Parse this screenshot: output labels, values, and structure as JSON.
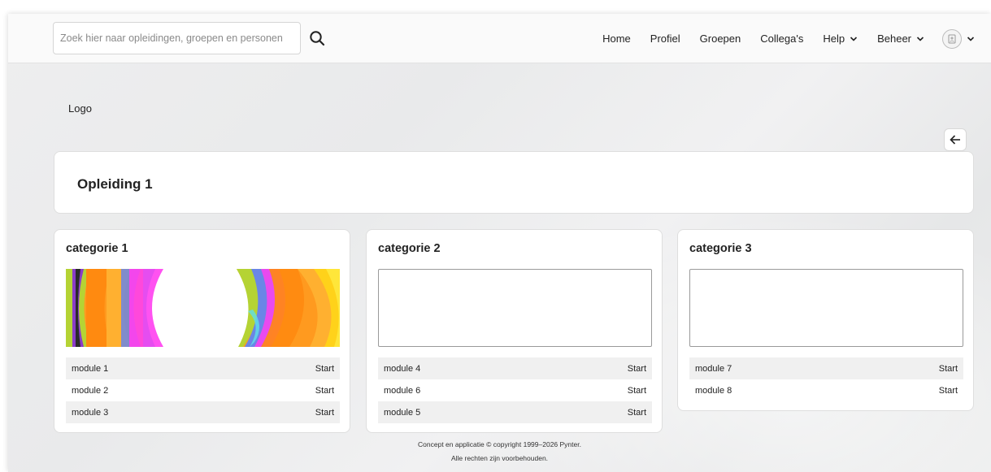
{
  "search": {
    "placeholder": "Zoek hier naar opleidingen, groepen en personen",
    "value": ""
  },
  "nav": {
    "home": "Home",
    "profiel": "Profiel",
    "groepen": "Groepen",
    "collegas": "Collega's",
    "help": "Help",
    "beheer": "Beheer"
  },
  "logo": "Logo",
  "page_title": "Opleiding 1",
  "categories": [
    {
      "title": "categorie 1",
      "modules": [
        {
          "name": "module 1",
          "action": "Start"
        },
        {
          "name": "module 2",
          "action": "Start"
        },
        {
          "name": "module 3",
          "action": "Start"
        }
      ]
    },
    {
      "title": "categorie 2",
      "modules": [
        {
          "name": "module 4",
          "action": "Start"
        },
        {
          "name": "module 6",
          "action": "Start"
        },
        {
          "name": "module 5",
          "action": "Start"
        }
      ]
    },
    {
      "title": "categorie 3",
      "modules": [
        {
          "name": "module 7",
          "action": "Start"
        },
        {
          "name": "module 8",
          "action": "Start"
        }
      ]
    }
  ],
  "footer": {
    "line1": "Concept en applicatie © copyright 1999–2026 Pynter.",
    "line2": "Alle rechten zijn voorbehouden."
  },
  "icons": {
    "search": "search-icon",
    "chevron": "chevron-down-icon",
    "avatar": "user-avatar-icon",
    "back": "arrow-left-icon"
  }
}
